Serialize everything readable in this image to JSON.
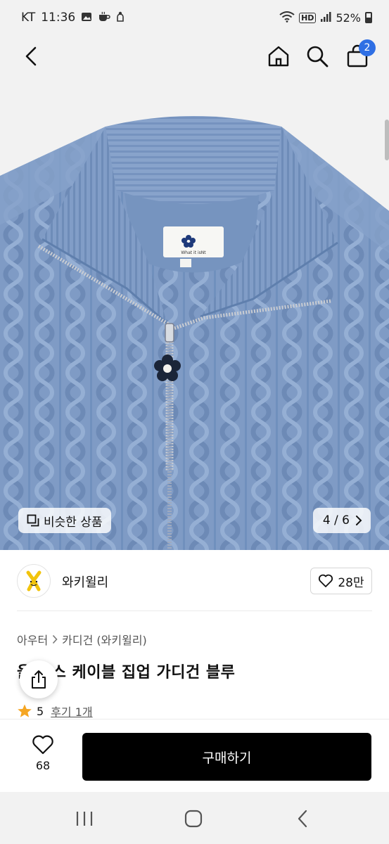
{
  "status_bar": {
    "carrier": "KT",
    "time": "11:36",
    "hd_label": "HD",
    "battery": "52%"
  },
  "header": {
    "cart_count": "2",
    "icons": [
      "back-icon",
      "home-icon",
      "search-icon",
      "shopping-bag-icon"
    ]
  },
  "gallery": {
    "similar_label": "비슷한 상품",
    "page_indicator": "4 / 6",
    "garment_label": "What it isNt"
  },
  "brand": {
    "name": "와키윌리",
    "likes": "28만"
  },
  "product": {
    "breadcrumb": [
      "아우터",
      "카디건 (와키윌리)"
    ],
    "title": "울 믹스 케이블 집업 가디건 블루",
    "rating": "5",
    "reviews": "후기 1개"
  },
  "bottom": {
    "wish_count": "68",
    "buy_label": "구매하기"
  },
  "colors": {
    "accent": "#2f6fe4",
    "sweater": "#7f9bc5",
    "star": "#f5a623",
    "buy_button": "#000000"
  }
}
